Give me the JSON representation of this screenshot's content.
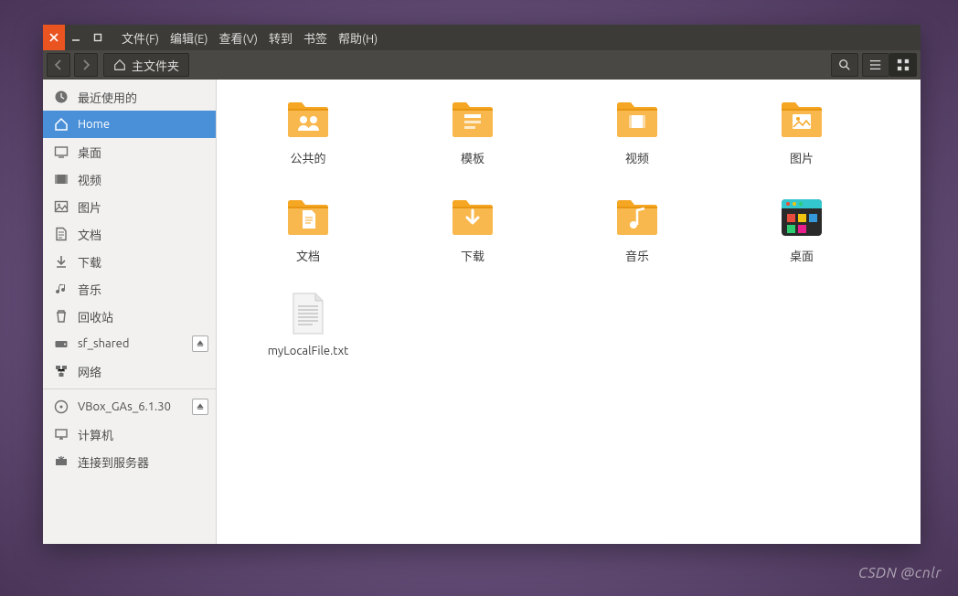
{
  "titlebar": {
    "menus": [
      "文件(F)",
      "编辑(E)",
      "查看(V)",
      "转到",
      "书签",
      "帮助(H)"
    ]
  },
  "toolbar": {
    "breadcrumb_icon": "home",
    "breadcrumb_label": "主文件夹"
  },
  "sidebar": {
    "section1": [
      {
        "icon": "clock",
        "label": "最近使用的",
        "active": false
      },
      {
        "icon": "home",
        "label": "Home",
        "active": true
      },
      {
        "icon": "desktop",
        "label": "桌面",
        "active": false
      },
      {
        "icon": "video",
        "label": "视频",
        "active": false
      },
      {
        "icon": "pictures",
        "label": "图片",
        "active": false
      },
      {
        "icon": "documents",
        "label": "文档",
        "active": false
      },
      {
        "icon": "download",
        "label": "下载",
        "active": false
      },
      {
        "icon": "music",
        "label": "音乐",
        "active": false
      },
      {
        "icon": "trash",
        "label": "回收站",
        "active": false
      },
      {
        "icon": "drive",
        "label": "sf_shared",
        "active": false,
        "eject": true
      },
      {
        "icon": "network-b",
        "label": "网络",
        "active": false
      }
    ],
    "section2": [
      {
        "icon": "disc",
        "label": "VBox_GAs_6.1.30",
        "active": false,
        "eject": true
      },
      {
        "icon": "computer",
        "label": "计算机",
        "active": false
      },
      {
        "icon": "connect",
        "label": "连接到服务器",
        "active": false
      }
    ]
  },
  "files": [
    {
      "type": "folder",
      "inner": "people",
      "label": "公共的"
    },
    {
      "type": "folder",
      "inner": "template",
      "label": "模板"
    },
    {
      "type": "folder",
      "inner": "video",
      "label": "视频"
    },
    {
      "type": "folder",
      "inner": "picture",
      "label": "图片"
    },
    {
      "type": "folder",
      "inner": "document",
      "label": "文档"
    },
    {
      "type": "folder",
      "inner": "download",
      "label": "下载"
    },
    {
      "type": "folder",
      "inner": "music",
      "label": "音乐"
    },
    {
      "type": "desktop-app",
      "inner": "",
      "label": "桌面"
    },
    {
      "type": "textfile",
      "inner": "",
      "label": "myLocalFile.txt"
    }
  ],
  "watermark": "CSDN @cnlr"
}
